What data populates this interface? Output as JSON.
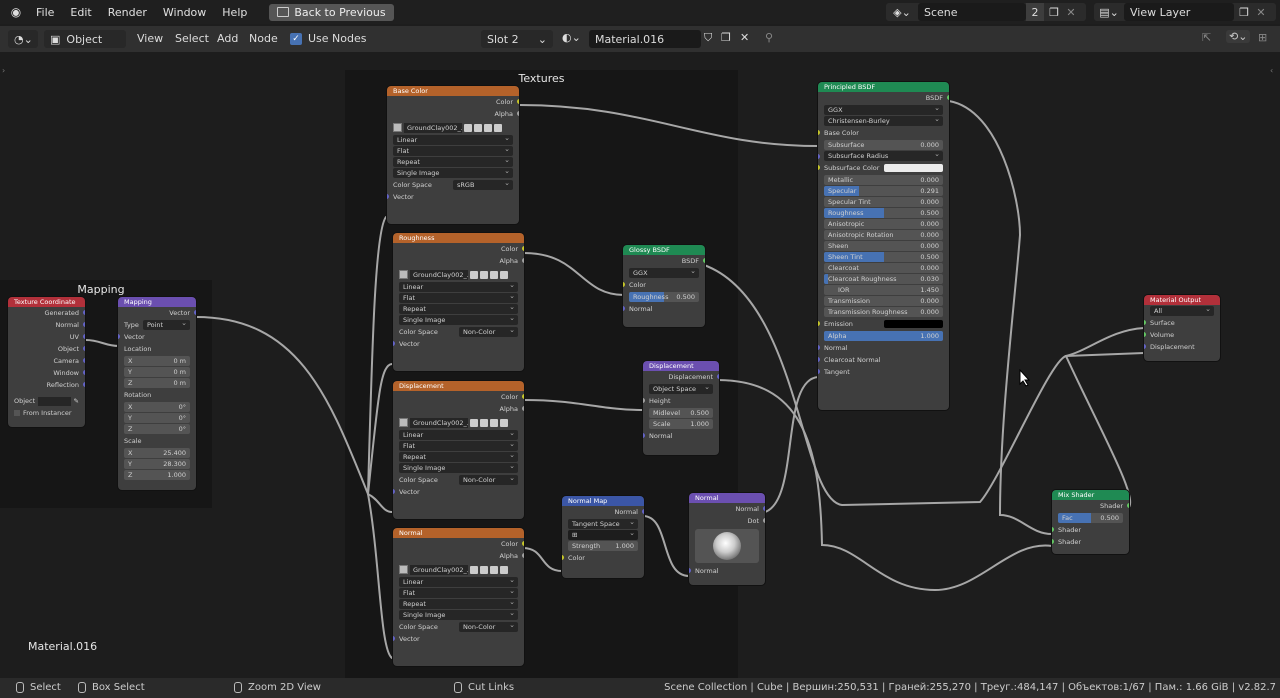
{
  "topbar": {
    "menus": [
      "File",
      "Edit",
      "Render",
      "Window",
      "Help"
    ],
    "back_button": "Back to Previous",
    "scene": "Scene",
    "scene_users": "2",
    "view_layer": "View Layer"
  },
  "header": {
    "mode": "Object",
    "menus": [
      "View",
      "Select",
      "Add",
      "Node"
    ],
    "use_nodes_label": "Use Nodes",
    "slot": "Slot 2",
    "material": "Material.016"
  },
  "frames": {
    "textures": "Textures",
    "mapping": "Mapping"
  },
  "nodes": {
    "texcoord": {
      "title": "Texture Coordinate",
      "outputs": [
        "Generated",
        "Normal",
        "UV",
        "Object",
        "Camera",
        "Window",
        "Reflection"
      ],
      "object_label": "Object",
      "from_instancer": "From Instancer"
    },
    "mapping": {
      "title": "Mapping",
      "output": "Vector",
      "type_label": "Type",
      "type_value": "Point",
      "vector": "Vector",
      "location": "Location",
      "loc": [
        {
          "axis": "X",
          "val": "0 m"
        },
        {
          "axis": "Y",
          "val": "0 m"
        },
        {
          "axis": "Z",
          "val": "0 m"
        }
      ],
      "rotation": "Rotation",
      "rot": [
        {
          "axis": "X",
          "val": "0°"
        },
        {
          "axis": "Y",
          "val": "0°"
        },
        {
          "axis": "Z",
          "val": "0°"
        }
      ],
      "scale": "Scale",
      "scl": [
        {
          "axis": "X",
          "val": "25.400"
        },
        {
          "axis": "Y",
          "val": "28.300"
        },
        {
          "axis": "Z",
          "val": "1.000"
        }
      ]
    },
    "basecolor": {
      "title": "Base Color",
      "out1": "Color",
      "out2": "Alpha",
      "image": "GroundClay002_...",
      "opts": [
        "Linear",
        "Flat",
        "Repeat",
        "Single Image"
      ],
      "cs_label": "Color Space",
      "cs_value": "sRGB",
      "vector": "Vector"
    },
    "roughness": {
      "title": "Roughness",
      "out1": "Color",
      "out2": "Alpha",
      "image": "GroundClay002_...",
      "opts": [
        "Linear",
        "Flat",
        "Repeat",
        "Single Image"
      ],
      "cs_label": "Color Space",
      "cs_value": "Non-Color",
      "vector": "Vector"
    },
    "displacement_tex": {
      "title": "Displacement",
      "out1": "Color",
      "out2": "Alpha",
      "image": "GroundClay002_...",
      "opts": [
        "Linear",
        "Flat",
        "Repeat",
        "Single Image"
      ],
      "cs_label": "Color Space",
      "cs_value": "Non-Color",
      "vector": "Vector"
    },
    "normal_tex": {
      "title": "Normal",
      "out1": "Color",
      "out2": "Alpha",
      "image": "GroundClay002_...",
      "opts": [
        "Linear",
        "Flat",
        "Repeat",
        "Single Image"
      ],
      "cs_label": "Color Space",
      "cs_value": "Non-Color",
      "vector": "Vector"
    },
    "glossy": {
      "title": "Glossy BSDF",
      "output": "BSDF",
      "dist": "GGX",
      "color": "Color",
      "roughness": "Roughness",
      "roughness_val": "0.500",
      "roughness_frac": 0.5,
      "normal": "Normal"
    },
    "displacement": {
      "title": "Displacement",
      "output": "Displacement",
      "space": "Object Space",
      "height": "Height",
      "midlevel": "Midlevel",
      "midlevel_val": "0.500",
      "scale": "Scale",
      "scale_val": "1.000",
      "normal": "Normal"
    },
    "normalmap": {
      "title": "Normal Map",
      "output": "Normal",
      "space": "Tangent Space",
      "strength": "Strength",
      "strength_val": "1.000",
      "color": "Color"
    },
    "normal": {
      "title": "Normal",
      "out1": "Normal",
      "out2": "Dot",
      "input": "Normal"
    },
    "principled": {
      "title": "Principled BSDF",
      "output": "BSDF",
      "dist": "GGX",
      "sss": "Christensen-Burley",
      "base_color": "Base Color",
      "fields": [
        {
          "name": "Subsurface",
          "val": "0.000",
          "frac": 0
        },
        {
          "name": "Subsurface Radius",
          "val": "",
          "frac": 0,
          "dd": true
        },
        {
          "name": "Subsurface Color",
          "val": "",
          "frac": 0,
          "white": true
        },
        {
          "name": "Metallic",
          "val": "0.000",
          "frac": 0
        },
        {
          "name": "Specular",
          "val": "0.291",
          "frac": 0.291
        },
        {
          "name": "Specular Tint",
          "val": "0.000",
          "frac": 0
        },
        {
          "name": "Roughness",
          "val": "0.500",
          "frac": 0.5
        },
        {
          "name": "Anisotropic",
          "val": "0.000",
          "frac": 0
        },
        {
          "name": "Anisotropic Rotation",
          "val": "0.000",
          "frac": 0
        },
        {
          "name": "Sheen",
          "val": "0.000",
          "frac": 0
        },
        {
          "name": "Sheen Tint",
          "val": "0.500",
          "frac": 0.5
        },
        {
          "name": "Clearcoat",
          "val": "0.000",
          "frac": 0
        },
        {
          "name": "Clearcoat Roughness",
          "val": "0.030",
          "frac": 0.03
        },
        {
          "name": "IOR",
          "val": "1.450",
          "frac": 0,
          "center": true
        },
        {
          "name": "Transmission",
          "val": "0.000",
          "frac": 0
        },
        {
          "name": "Transmission Roughness",
          "val": "0.000",
          "frac": 0
        },
        {
          "name": "Emission",
          "val": "",
          "frac": 0,
          "black": true
        },
        {
          "name": "Alpha",
          "val": "1.000",
          "frac": 1
        }
      ],
      "tail": [
        "Normal",
        "Clearcoat Normal",
        "Tangent"
      ]
    },
    "output": {
      "title": "Material Output",
      "target": "All",
      "inputs": [
        "Surface",
        "Volume",
        "Displacement"
      ]
    },
    "mix": {
      "title": "Mix Shader",
      "output": "Shader",
      "fac": "Fac",
      "fac_val": "0.500",
      "fac_frac": 0.5,
      "in1": "Shader",
      "in2": "Shader"
    }
  },
  "material_label": "Material.016",
  "footer": {
    "select": "Select",
    "box_select": "Box Select",
    "zoom": "Zoom 2D View",
    "cut": "Cut Links",
    "stats": "Scene Collection | Cube | Вершин:250,531 | Граней:255,270 | Треуг.:484,147 | Объектов:1/67 | Пам.: 1.66 GiB | v2.82.7"
  },
  "colors": {
    "texture_header": "#b4622a",
    "input_header": "#b2303a",
    "vector_header": "#6b4fb0",
    "shader_header": "#1f8a53",
    "accent": "#4772b3"
  }
}
